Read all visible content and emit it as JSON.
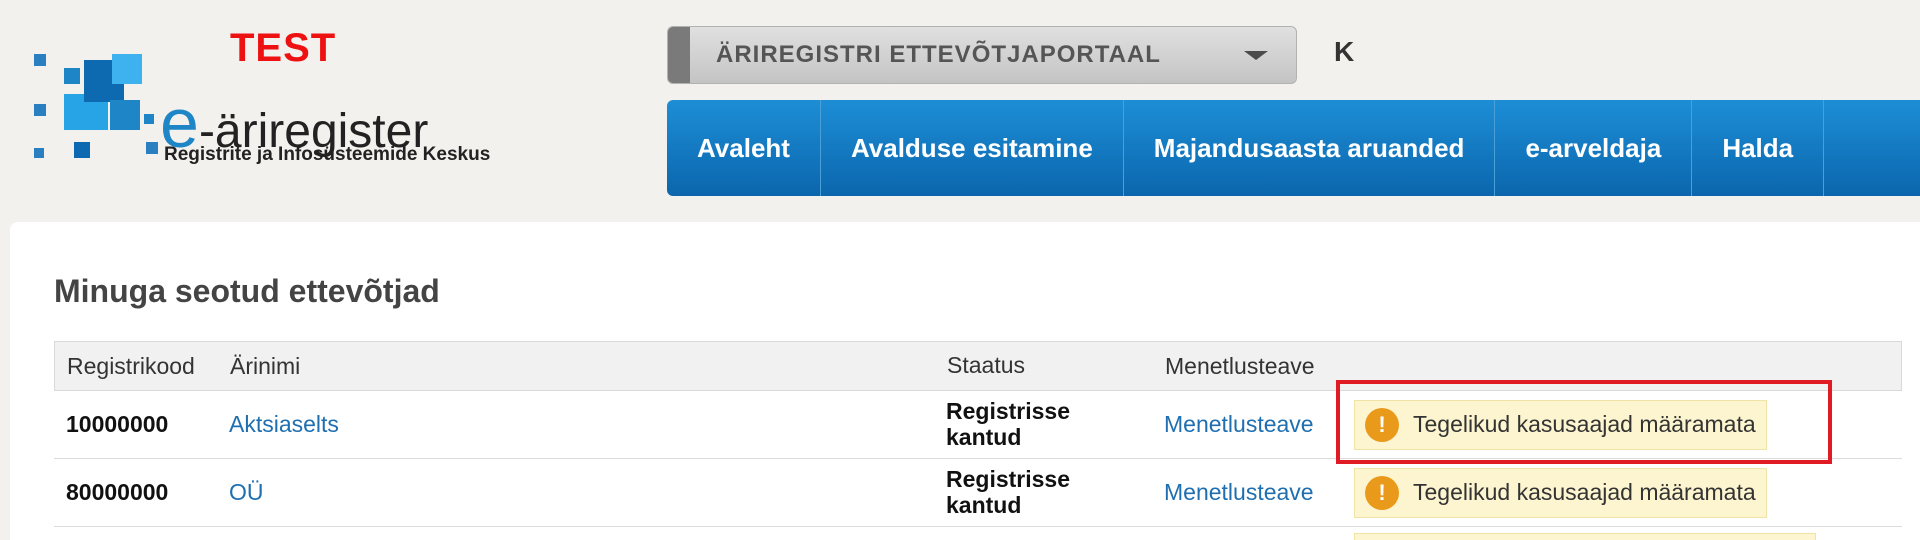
{
  "header": {
    "env_label": "TEST",
    "logo_brand_e": "e",
    "logo_brand_rest": "-äriregister",
    "logo_subtitle": "Registrite ja Infosüsteemide Keskus",
    "portal_select": "ÄRIREGISTRI ETTEVÕTJAPORTAAL",
    "user_initial": "K"
  },
  "nav": {
    "items": [
      {
        "label": "Avaleht"
      },
      {
        "label": "Avalduse esitamine"
      },
      {
        "label": "Majandusaasta aruanded"
      },
      {
        "label": "e-arveldaja"
      },
      {
        "label": "Halda"
      }
    ]
  },
  "main": {
    "title": "Minuga seotud ettevõtjad",
    "table": {
      "headers": {
        "code": "Registrikood",
        "name": "Ärinimi",
        "status": "Staatus",
        "procedure": "Menetlusteave"
      },
      "rows": [
        {
          "code": "10000000",
          "name": "Aktsiaselts",
          "status": "Registrisse kantud",
          "procedure": "Menetlusteave",
          "warning": "Tegelikud kasusaajad määramata"
        },
        {
          "code": "80000000",
          "name": "OÜ",
          "status": "Registrisse kantud",
          "procedure": "Menetlusteave",
          "warning": "Tegelikud kasusaajad määramata"
        }
      ]
    }
  },
  "icons": {
    "warning": "!"
  },
  "colors": {
    "nav_blue": "#1d8ed6",
    "test_red": "#ee1111",
    "warning_orange": "#ea9a1a",
    "highlight_red": "#e01b24"
  }
}
